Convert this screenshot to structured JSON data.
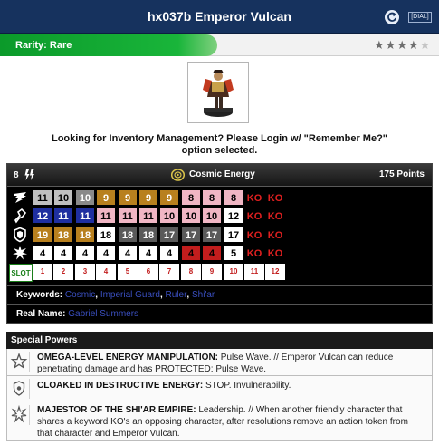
{
  "header": {
    "title": "hx037b Emperor Vulcan",
    "dial_label": "[DIAL]",
    "reset_icon": "refresh-icon"
  },
  "rarity": {
    "label": "Rarity: Rare",
    "stars_filled": 4,
    "stars_total": 5,
    "band_color": "#19b53a"
  },
  "login_message": "Looking for Inventory Management? Please Login w/ \"Remember Me?\" option selected.",
  "card": {
    "range": "8",
    "team": "Cosmic Energy",
    "points": "175 Points",
    "stat_icons": [
      "speed-wing-icon",
      "attack-fist-icon",
      "defense-shield-icon",
      "damage-burst-icon"
    ],
    "slot_label": "SLOT",
    "dial": {
      "clicks": [
        {
          "slot": "1",
          "values": [
            {
              "v": "11",
              "bg": "#bfbfbf",
              "fg": "#000000"
            },
            {
              "v": "12",
              "bg": "#1f2fa0",
              "fg": "#ffffff"
            },
            {
              "v": "19",
              "bg": "#b8801e",
              "fg": "#ffffff"
            },
            {
              "v": "4",
              "bg": "#ffffff",
              "fg": "#000000"
            }
          ]
        },
        {
          "slot": "2",
          "values": [
            {
              "v": "10",
              "bg": "#bfbfbf",
              "fg": "#000000"
            },
            {
              "v": "11",
              "bg": "#1f2fa0",
              "fg": "#ffffff"
            },
            {
              "v": "18",
              "bg": "#b8801e",
              "fg": "#ffffff"
            },
            {
              "v": "4",
              "bg": "#ffffff",
              "fg": "#000000"
            }
          ]
        },
        {
          "slot": "3",
          "values": [
            {
              "v": "10",
              "bg": "#8a8a8a",
              "fg": "#ffffff"
            },
            {
              "v": "11",
              "bg": "#1f2fa0",
              "fg": "#ffffff"
            },
            {
              "v": "18",
              "bg": "#b8801e",
              "fg": "#ffffff"
            },
            {
              "v": "4",
              "bg": "#ffffff",
              "fg": "#000000"
            }
          ]
        },
        {
          "slot": "4",
          "values": [
            {
              "v": "9",
              "bg": "#b8801e",
              "fg": "#ffffff"
            },
            {
              "v": "11",
              "bg": "#f0b6c4",
              "fg": "#000000"
            },
            {
              "v": "18",
              "bg": "#ffffff",
              "fg": "#000000"
            },
            {
              "v": "4",
              "bg": "#ffffff",
              "fg": "#000000"
            }
          ]
        },
        {
          "slot": "5",
          "values": [
            {
              "v": "9",
              "bg": "#b8801e",
              "fg": "#ffffff"
            },
            {
              "v": "11",
              "bg": "#f0b6c4",
              "fg": "#000000"
            },
            {
              "v": "18",
              "bg": "#5a5a5a",
              "fg": "#ffffff"
            },
            {
              "v": "4",
              "bg": "#ffffff",
              "fg": "#000000"
            }
          ]
        },
        {
          "slot": "6",
          "values": [
            {
              "v": "9",
              "bg": "#b8801e",
              "fg": "#ffffff"
            },
            {
              "v": "11",
              "bg": "#f0b6c4",
              "fg": "#000000"
            },
            {
              "v": "18",
              "bg": "#5a5a5a",
              "fg": "#ffffff"
            },
            {
              "v": "4",
              "bg": "#ffffff",
              "fg": "#000000"
            }
          ]
        },
        {
          "slot": "7",
          "values": [
            {
              "v": "9",
              "bg": "#b8801e",
              "fg": "#ffffff"
            },
            {
              "v": "10",
              "bg": "#f0b6c4",
              "fg": "#000000"
            },
            {
              "v": "17",
              "bg": "#5a5a5a",
              "fg": "#ffffff"
            },
            {
              "v": "4",
              "bg": "#ffffff",
              "fg": "#000000"
            }
          ]
        },
        {
          "slot": "8",
          "values": [
            {
              "v": "8",
              "bg": "#f0b6c4",
              "fg": "#000000"
            },
            {
              "v": "10",
              "bg": "#f0b6c4",
              "fg": "#000000"
            },
            {
              "v": "17",
              "bg": "#5a5a5a",
              "fg": "#ffffff"
            },
            {
              "v": "4",
              "bg": "#c21d1d",
              "fg": "#000000"
            }
          ]
        },
        {
          "slot": "9",
          "values": [
            {
              "v": "8",
              "bg": "#f0b6c4",
              "fg": "#000000"
            },
            {
              "v": "10",
              "bg": "#f0b6c4",
              "fg": "#000000"
            },
            {
              "v": "17",
              "bg": "#5a5a5a",
              "fg": "#ffffff"
            },
            {
              "v": "4",
              "bg": "#c21d1d",
              "fg": "#000000"
            }
          ]
        },
        {
          "slot": "10",
          "values": [
            {
              "v": "8",
              "bg": "#f0b6c4",
              "fg": "#000000"
            },
            {
              "v": "12",
              "bg": "#ffffff",
              "fg": "#000000"
            },
            {
              "v": "17",
              "bg": "#ffffff",
              "fg": "#000000"
            },
            {
              "v": "5",
              "bg": "#ffffff",
              "fg": "#000000"
            }
          ]
        },
        {
          "slot": "11",
          "values": [
            {
              "v": "KO",
              "bg": "#000000",
              "fg": "#e02020"
            },
            {
              "v": "KO",
              "bg": "#000000",
              "fg": "#e02020"
            },
            {
              "v": "KO",
              "bg": "#000000",
              "fg": "#e02020"
            },
            {
              "v": "KO",
              "bg": "#000000",
              "fg": "#e02020"
            }
          ]
        },
        {
          "slot": "12",
          "values": [
            {
              "v": "KO",
              "bg": "#000000",
              "fg": "#e02020"
            },
            {
              "v": "KO",
              "bg": "#000000",
              "fg": "#e02020"
            },
            {
              "v": "KO",
              "bg": "#000000",
              "fg": "#e02020"
            },
            {
              "v": "KO",
              "bg": "#000000",
              "fg": "#e02020"
            }
          ]
        }
      ]
    },
    "keywords_label": "Keywords:",
    "keywords": [
      "Cosmic",
      "Imperial Guard",
      "Ruler",
      "Shi'ar"
    ],
    "real_name_label": "Real Name:",
    "real_name": "Gabriel Summers"
  },
  "special_powers": {
    "title": "Special Powers",
    "items": [
      {
        "icon": "star-icon",
        "name": "OMEGA-LEVEL ENERGY MANIPULATION:",
        "text": " Pulse Wave. // Emperor Vulcan can reduce penetrating damage and has PROTECTED: Pulse Wave."
      },
      {
        "icon": "shield-icon",
        "name": "CLOAKED IN DESTRUCTIVE ENERGY:",
        "text": " STOP. Invulnerability."
      },
      {
        "icon": "burst-icon",
        "name": "MAJESTOR OF THE SHI'AR EMPIRE:",
        "text": " Leadership. // When another friendly character that shares a keyword KO's an opposing character, after resolutions remove an action token from that character and Emperor Vulcan."
      }
    ]
  }
}
